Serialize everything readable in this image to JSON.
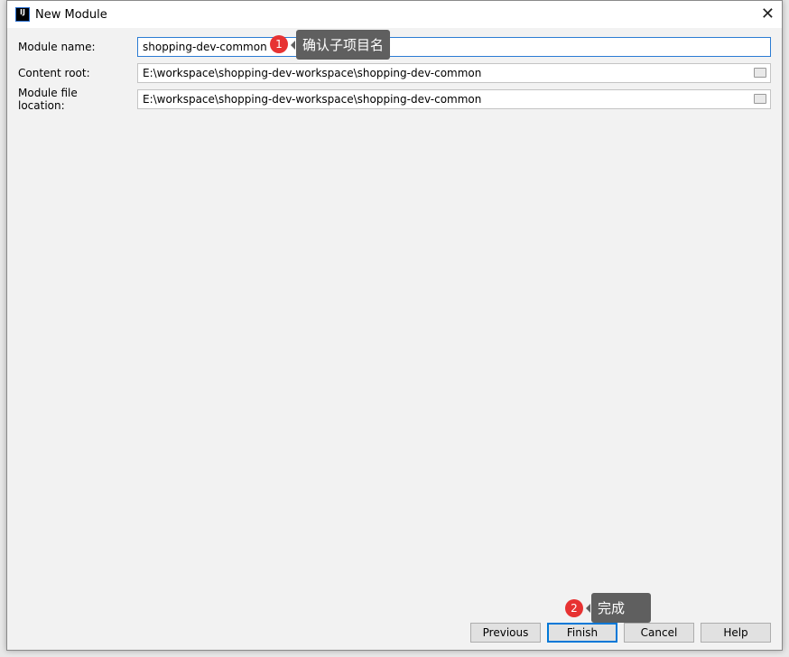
{
  "dialog": {
    "title": "New Module",
    "logo": "IJ"
  },
  "form": {
    "module_name": {
      "label": "Module name:",
      "value": "shopping-dev-common"
    },
    "content_root": {
      "label": "Content root:",
      "value": "E:\\workspace\\shopping-dev-workspace\\shopping-dev-common"
    },
    "module_file_location": {
      "label": "Module file location:",
      "value": "E:\\workspace\\shopping-dev-workspace\\shopping-dev-common"
    }
  },
  "annotations": [
    {
      "number": "1",
      "text": "确认子项目名"
    },
    {
      "number": "2",
      "text": "完成"
    }
  ],
  "buttons": {
    "previous": "Previous",
    "finish": "Finish",
    "cancel": "Cancel",
    "help": "Help"
  }
}
